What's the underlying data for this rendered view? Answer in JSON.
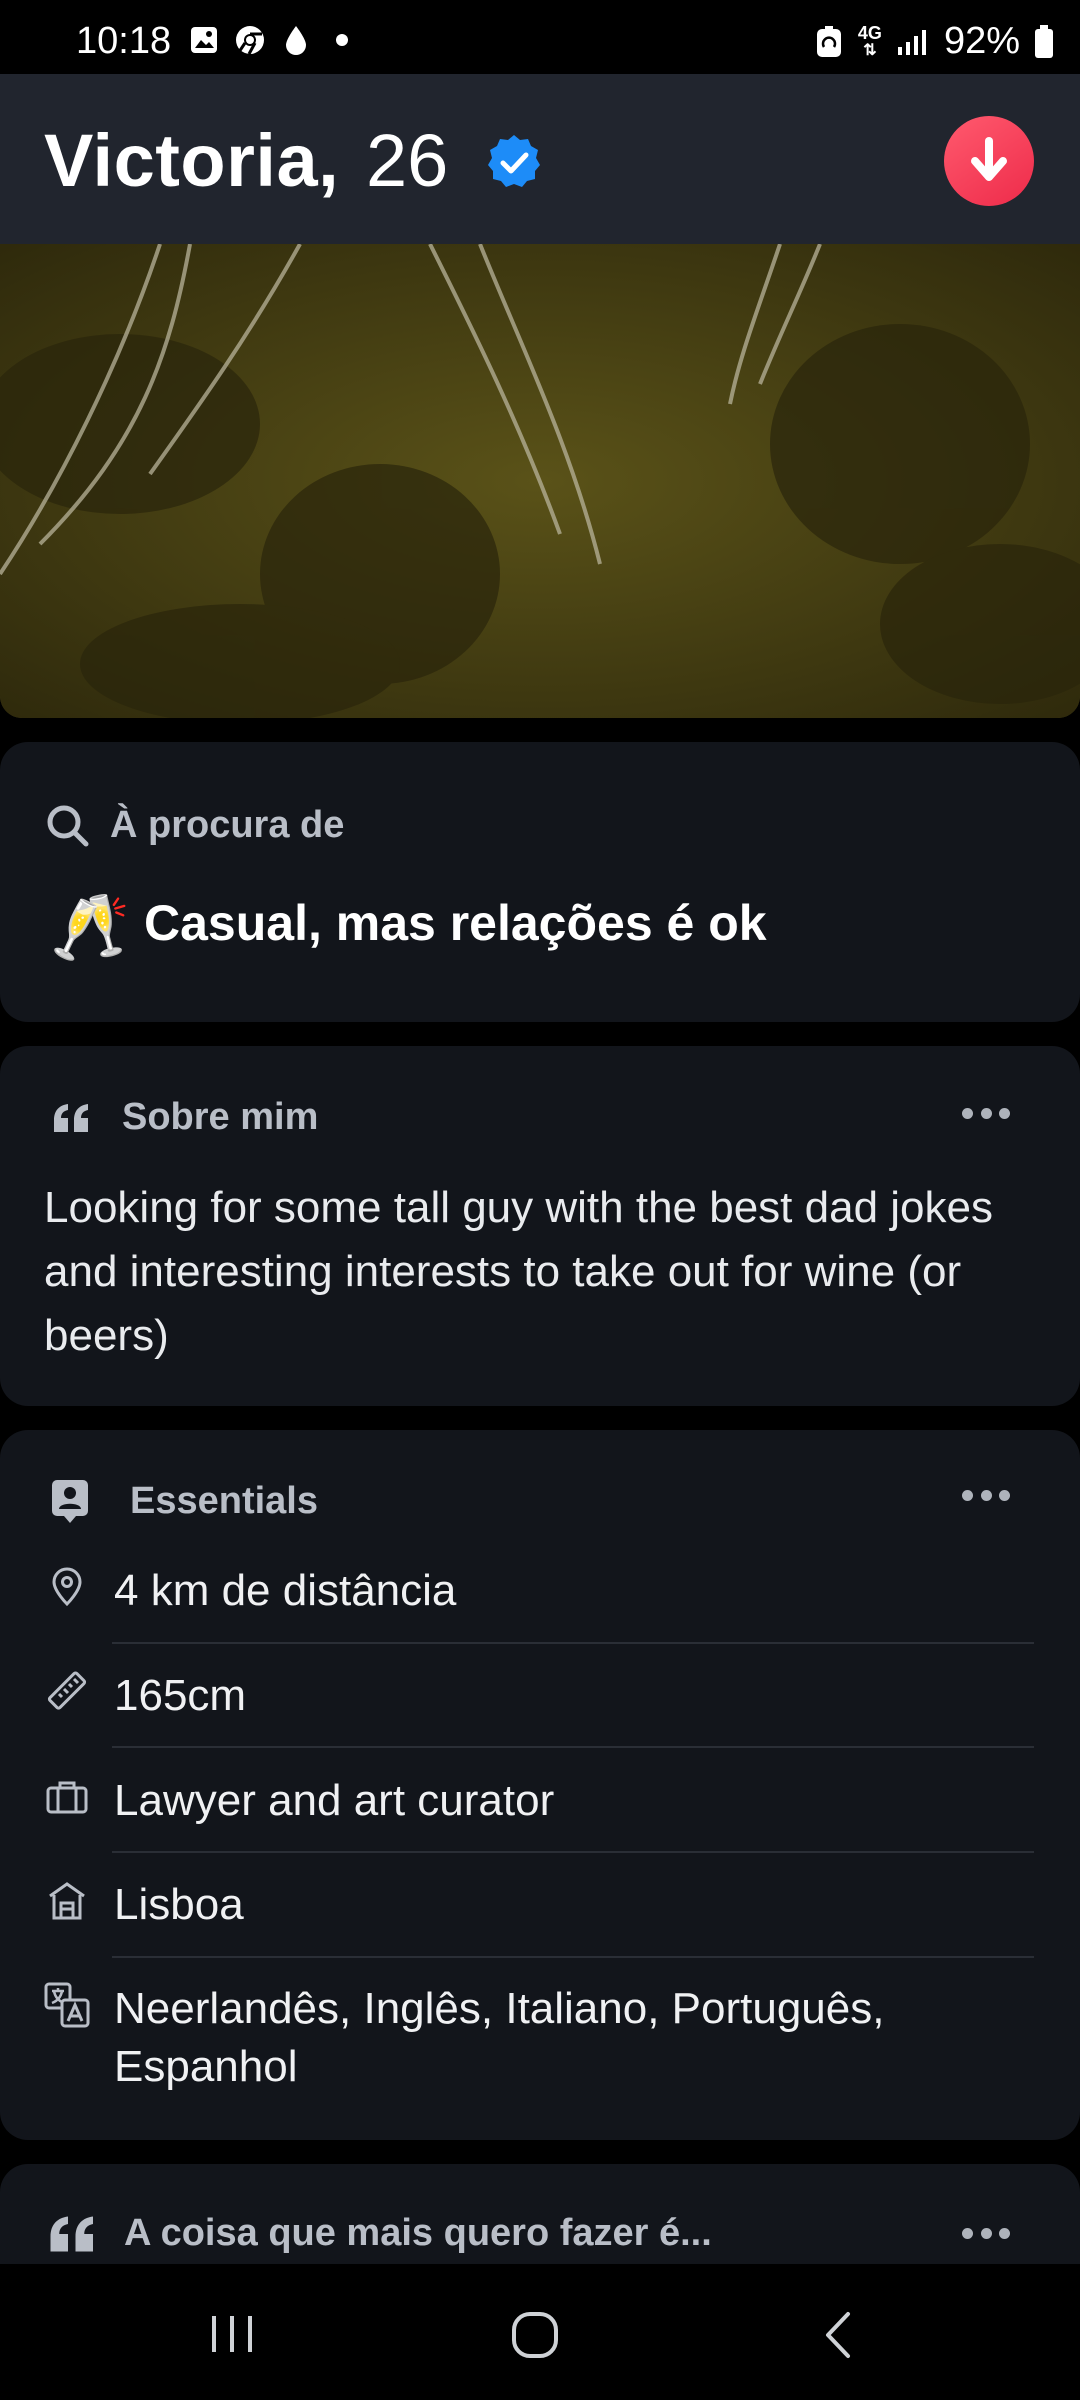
{
  "status_bar": {
    "time": "10:18",
    "signal_label": "4G",
    "battery": "92%"
  },
  "profile": {
    "name": "Victoria,",
    "age": "26",
    "verified": true
  },
  "looking_for": {
    "title": "À procura de",
    "emoji": "🥂",
    "value": "Casual, mas relações é ok"
  },
  "about": {
    "title": "Sobre mim",
    "text": "Looking for some tall guy with the best dad jokes and interesting interests to take out for wine (or beers)"
  },
  "essentials": {
    "title": "Essentials",
    "items": [
      {
        "icon": "location-pin-icon",
        "text": "4 km de distância"
      },
      {
        "icon": "ruler-icon",
        "text": "165cm"
      },
      {
        "icon": "briefcase-icon",
        "text": "Lawyer and art curator"
      },
      {
        "icon": "house-icon",
        "text": "Lisboa"
      },
      {
        "icon": "translate-icon",
        "text": "Neerlandês, Inglês, Italiano, Português, Espanhol"
      }
    ]
  },
  "prompt": {
    "title": "A coisa que mais quero fazer é..."
  },
  "colors": {
    "background": "#000000",
    "header": "#21252e",
    "card": "#12151b",
    "accent_red": "#f03a55",
    "verified_blue": "#1d8cf8"
  }
}
